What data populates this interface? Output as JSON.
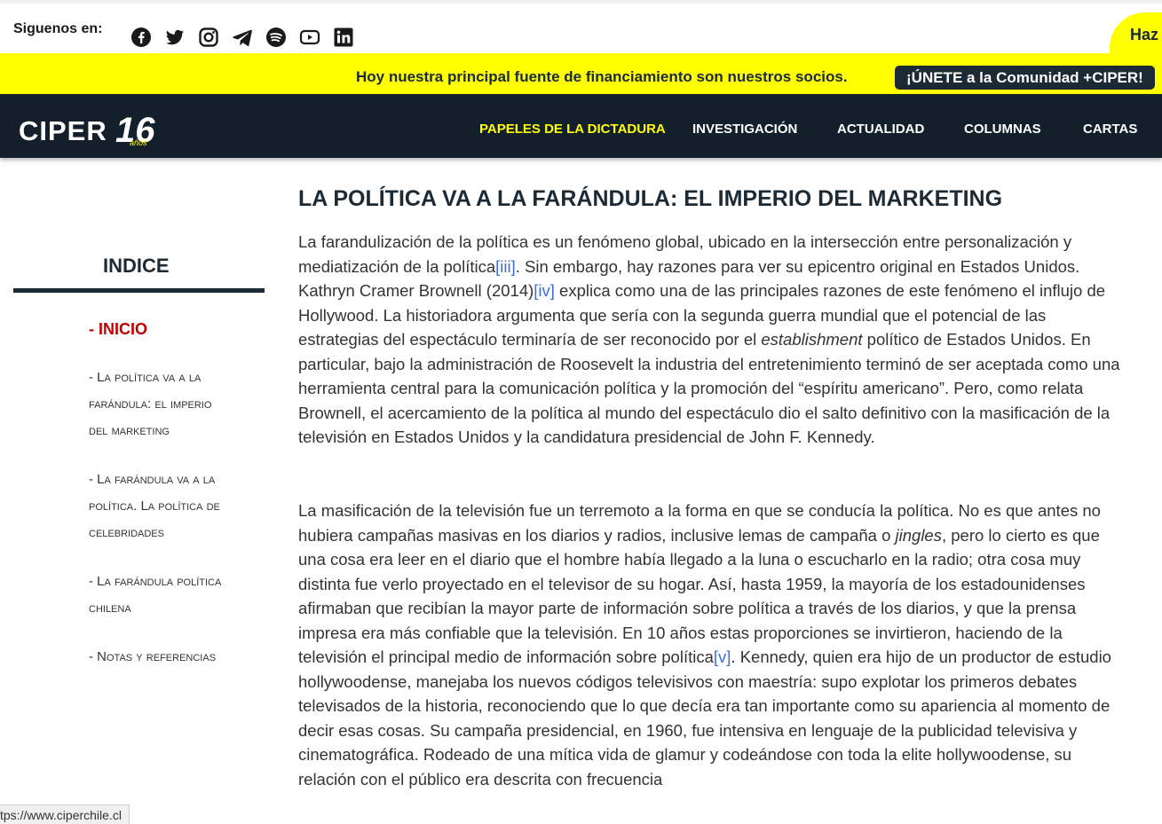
{
  "social": {
    "label": "Siguenos en:",
    "icons": [
      "facebook-icon",
      "twitter-icon",
      "instagram-icon",
      "telegram-icon",
      "spotify-icon",
      "youtube-icon",
      "linkedin-icon"
    ],
    "cta_partial": "Haz"
  },
  "banner": {
    "message": "Hoy nuestra principal fuente de financiamiento son nuestros socios.",
    "join_label": "¡ÚNETE a la Comunidad +CIPER!"
  },
  "nav": {
    "logo": "CIPER",
    "logo_badge": "16",
    "logo_badge_sub": "años",
    "items": [
      "PAPELES DE LA DICTADURA",
      "INVESTIGACIÓN",
      "ACTUALIDAD",
      "COLUMNAS",
      "CARTAS"
    ]
  },
  "sidebar": {
    "title": "INDICE",
    "home": "- INICIO",
    "items": [
      [
        "- La política va a la",
        "farándula: el imperio",
        "del marketing"
      ],
      [
        "- La farándula va a la",
        "política. La política de",
        "celebridades"
      ],
      [
        "- La farándula política",
        "chilena"
      ],
      [
        "- Notas y referencias"
      ]
    ]
  },
  "article": {
    "headline": "LA POLÍTICA VA A LA FARÁNDULA: EL IMPERIO DEL MARKETING",
    "p1": {
      "a": "La farandulización de la política es un fenómeno global, ubicado en la intersección entre personalización y mediatización de la política",
      "ref1": "[iii]",
      "b": ". Sin embargo, hay razones para ver su epicentro original en Estados Unidos. Kathryn Cramer Brownell (2014)",
      "ref2": "[iv]",
      "c": " explica como una de las principales razones de este fenómeno el influjo de Hollywood. La historiadora argumenta que sería con la segunda guerra mundial que el potencial de las estrategias del espectáculo terminaría de ser reconocido por el ",
      "em": "establishment",
      "d": " político de Estados Unidos. En particular, bajo la administración de Roosevelt la industria del entretenimiento terminó de ser aceptada como una herramienta central para la comunicación política y la promoción del “espíritu americano”. Pero, como relata Brownell, el acercamiento de la política al mundo del espectáculo dio el salto definitivo con la masificación de la televisión en Estados Unidos y la candidatura presidencial de John F. Kennedy."
    },
    "p2": {
      "a": "La masificación de la televisión fue un terremoto a la forma en que se conducía la política. No es que antes no hubiera campañas masivas en los diarios y radios, inclusive lemas de campaña o ",
      "em": "jingles",
      "b": ", pero lo cierto es que una cosa era leer en el diario que el hombre había llegado a la luna o escucharlo en la radio; otra cosa muy distinta fue verlo proyectado en el televisor de su hogar. Así, hasta 1959, la mayoría de los estadounidenses afirmaban que recibían la mayor parte de información sobre política a través de los diarios, y que la prensa impresa era más confiable que la televisión. En 10 años estas proporciones se invirtieron, haciendo de la televisión el principal medio de información sobre política",
      "ref": "[v]",
      "c": ". Kennedy, quien era hijo de un productor de estudio hollywoodense, manejaba los nuevos códigos televisivos con maestría: supo explotar los primeros debates televisados de la historia, reconociendo que lo que decía era tan importante como su apariencia al momento de decir esas cosas. Su campaña presidencial, en 1960, fue intensiva en lenguaje de la publicidad televisiva y cinematográfica. Rodeado de una mítica vida de glamur y codeándose con toda la elite hollywoodense, su relación con el público era descrita con frecuencia"
    }
  },
  "status_url": "tps://www.ciperchile.cl"
}
